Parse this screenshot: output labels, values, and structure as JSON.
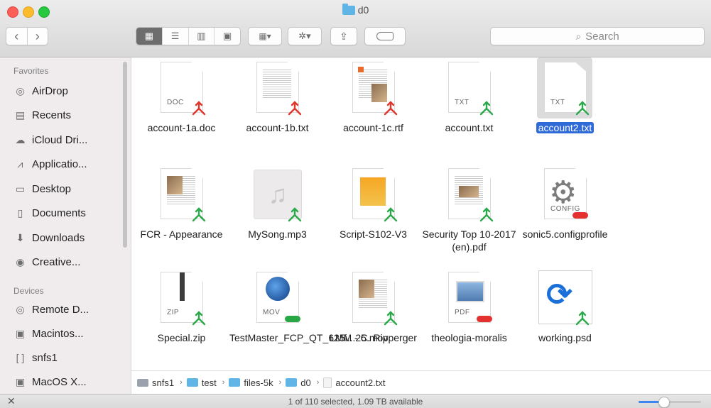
{
  "window": {
    "title": "d0"
  },
  "toolbar": {
    "back_glyph": "‹",
    "forward_glyph": "›",
    "view_buttons": [
      {
        "name": "icon-view-icon",
        "glyph": "▦",
        "active": true
      },
      {
        "name": "list-view-icon",
        "glyph": "☰",
        "active": false
      },
      {
        "name": "column-view-icon",
        "glyph": "▥",
        "active": false
      },
      {
        "name": "gallery-view-icon",
        "glyph": "▣",
        "active": false
      }
    ],
    "arrange_glyph": "▦▾",
    "action_glyph": "✲▾",
    "share_glyph": "⇪",
    "search_placeholder": "Search"
  },
  "sidebar": {
    "favorites_heading": "Favorites",
    "devices_heading": "Devices",
    "favorites": [
      {
        "label": "AirDrop",
        "icon": "airdrop-icon",
        "glyph": "◎"
      },
      {
        "label": "Recents",
        "icon": "recents-icon",
        "glyph": "▤"
      },
      {
        "label": "iCloud Dri...",
        "icon": "cloud-icon",
        "glyph": "☁"
      },
      {
        "label": "Applicatio...",
        "icon": "applications-icon",
        "glyph": "⩘"
      },
      {
        "label": "Desktop",
        "icon": "desktop-icon",
        "glyph": "▭"
      },
      {
        "label": "Documents",
        "icon": "documents-icon",
        "glyph": "▯"
      },
      {
        "label": "Downloads",
        "icon": "downloads-icon",
        "glyph": "⬇"
      },
      {
        "label": "Creative...",
        "icon": "creative-cloud-icon",
        "glyph": "◉"
      }
    ],
    "devices": [
      {
        "label": "Remote D...",
        "icon": "remote-disc-icon",
        "glyph": "◎"
      },
      {
        "label": "Macintos...",
        "icon": "hard-drive-icon",
        "glyph": "▣"
      },
      {
        "label": "snfs1",
        "icon": "network-volume-icon",
        "glyph": "[ ]"
      },
      {
        "label": "MacOS X...",
        "icon": "disk-icon",
        "glyph": "▣"
      }
    ]
  },
  "files": [
    {
      "name": "account-1a.doc",
      "kind": "doc",
      "ext": "DOC",
      "badge": "sync"
    },
    {
      "name": "account-1b.txt",
      "kind": "lines",
      "ext": "",
      "badge": "sync"
    },
    {
      "name": "account-1c.rtf",
      "kind": "rtf",
      "ext": "",
      "badge": "sync"
    },
    {
      "name": "account.txt",
      "kind": "txt",
      "ext": "TXT",
      "badge": "sync-green"
    },
    {
      "name": "account2.txt",
      "kind": "txt",
      "ext": "TXT",
      "badge": "sync-green",
      "selected": true
    },
    {
      "name": "FCR - Appearance",
      "kind": "pdf",
      "ext": "",
      "badge": "sync-green"
    },
    {
      "name": "MySong.mp3",
      "kind": "music",
      "ext": "",
      "badge": "sync-green"
    },
    {
      "name": "Script-S102-V3",
      "kind": "pages",
      "ext": "",
      "badge": "sync-green"
    },
    {
      "name": "Security Top 10-2017 (en).pdf",
      "kind": "pdf2",
      "ext": "",
      "badge": "sync-green"
    },
    {
      "name": "sonic5.configprofile",
      "kind": "config",
      "ext": "CONFIG",
      "badge": "pill-red"
    },
    {
      "name": "Special.zip",
      "kind": "zip",
      "ext": "ZIP",
      "badge": "sync-green"
    },
    {
      "name": "TestMaster_FCP_QT_625i...25.mov",
      "kind": "mov",
      "ext": "MOV",
      "badge": "pill-green"
    },
    {
      "name": "LMM - C. Ripperger",
      "kind": "pdf",
      "ext": "",
      "badge": "sync-green"
    },
    {
      "name": "theologia-moralis",
      "kind": "preview",
      "ext": "PDF",
      "badge": "pill-red"
    },
    {
      "name": "working.psd",
      "kind": "psd",
      "ext": "",
      "badge": "sync-green"
    }
  ],
  "pathbar": [
    {
      "label": "snfs1",
      "type": "disk"
    },
    {
      "label": "test",
      "type": "folder"
    },
    {
      "label": "files-5k",
      "type": "folder"
    },
    {
      "label": "d0",
      "type": "folder"
    },
    {
      "label": "account2.txt",
      "type": "file"
    }
  ],
  "pathbar_sep": "›",
  "status": {
    "text": "1 of 110 selected, 1.09 TB available",
    "close_glyph": "✕",
    "icon_size_slider_fraction": 0.4
  },
  "colors": {
    "selection": "#2f6ad9",
    "folder": "#5fb5e6",
    "sync_red": "#e0352b",
    "sync_green": "#2ba84a"
  }
}
